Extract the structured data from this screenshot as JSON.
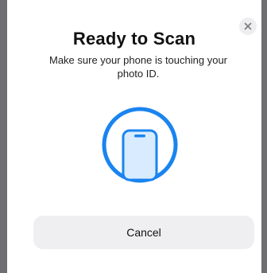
{
  "sheet": {
    "title": "Ready to Scan",
    "subtitle": "Make sure your phone is touching your photo ID.",
    "close_icon": "close-icon",
    "graphic_icon": "phone-scan-icon",
    "cancel_label": "Cancel"
  },
  "colors": {
    "accent": "#1a84f0",
    "phone_fill": "#d9ecff",
    "button_bg": "#efeff1",
    "backdrop": "#6f6f72"
  }
}
